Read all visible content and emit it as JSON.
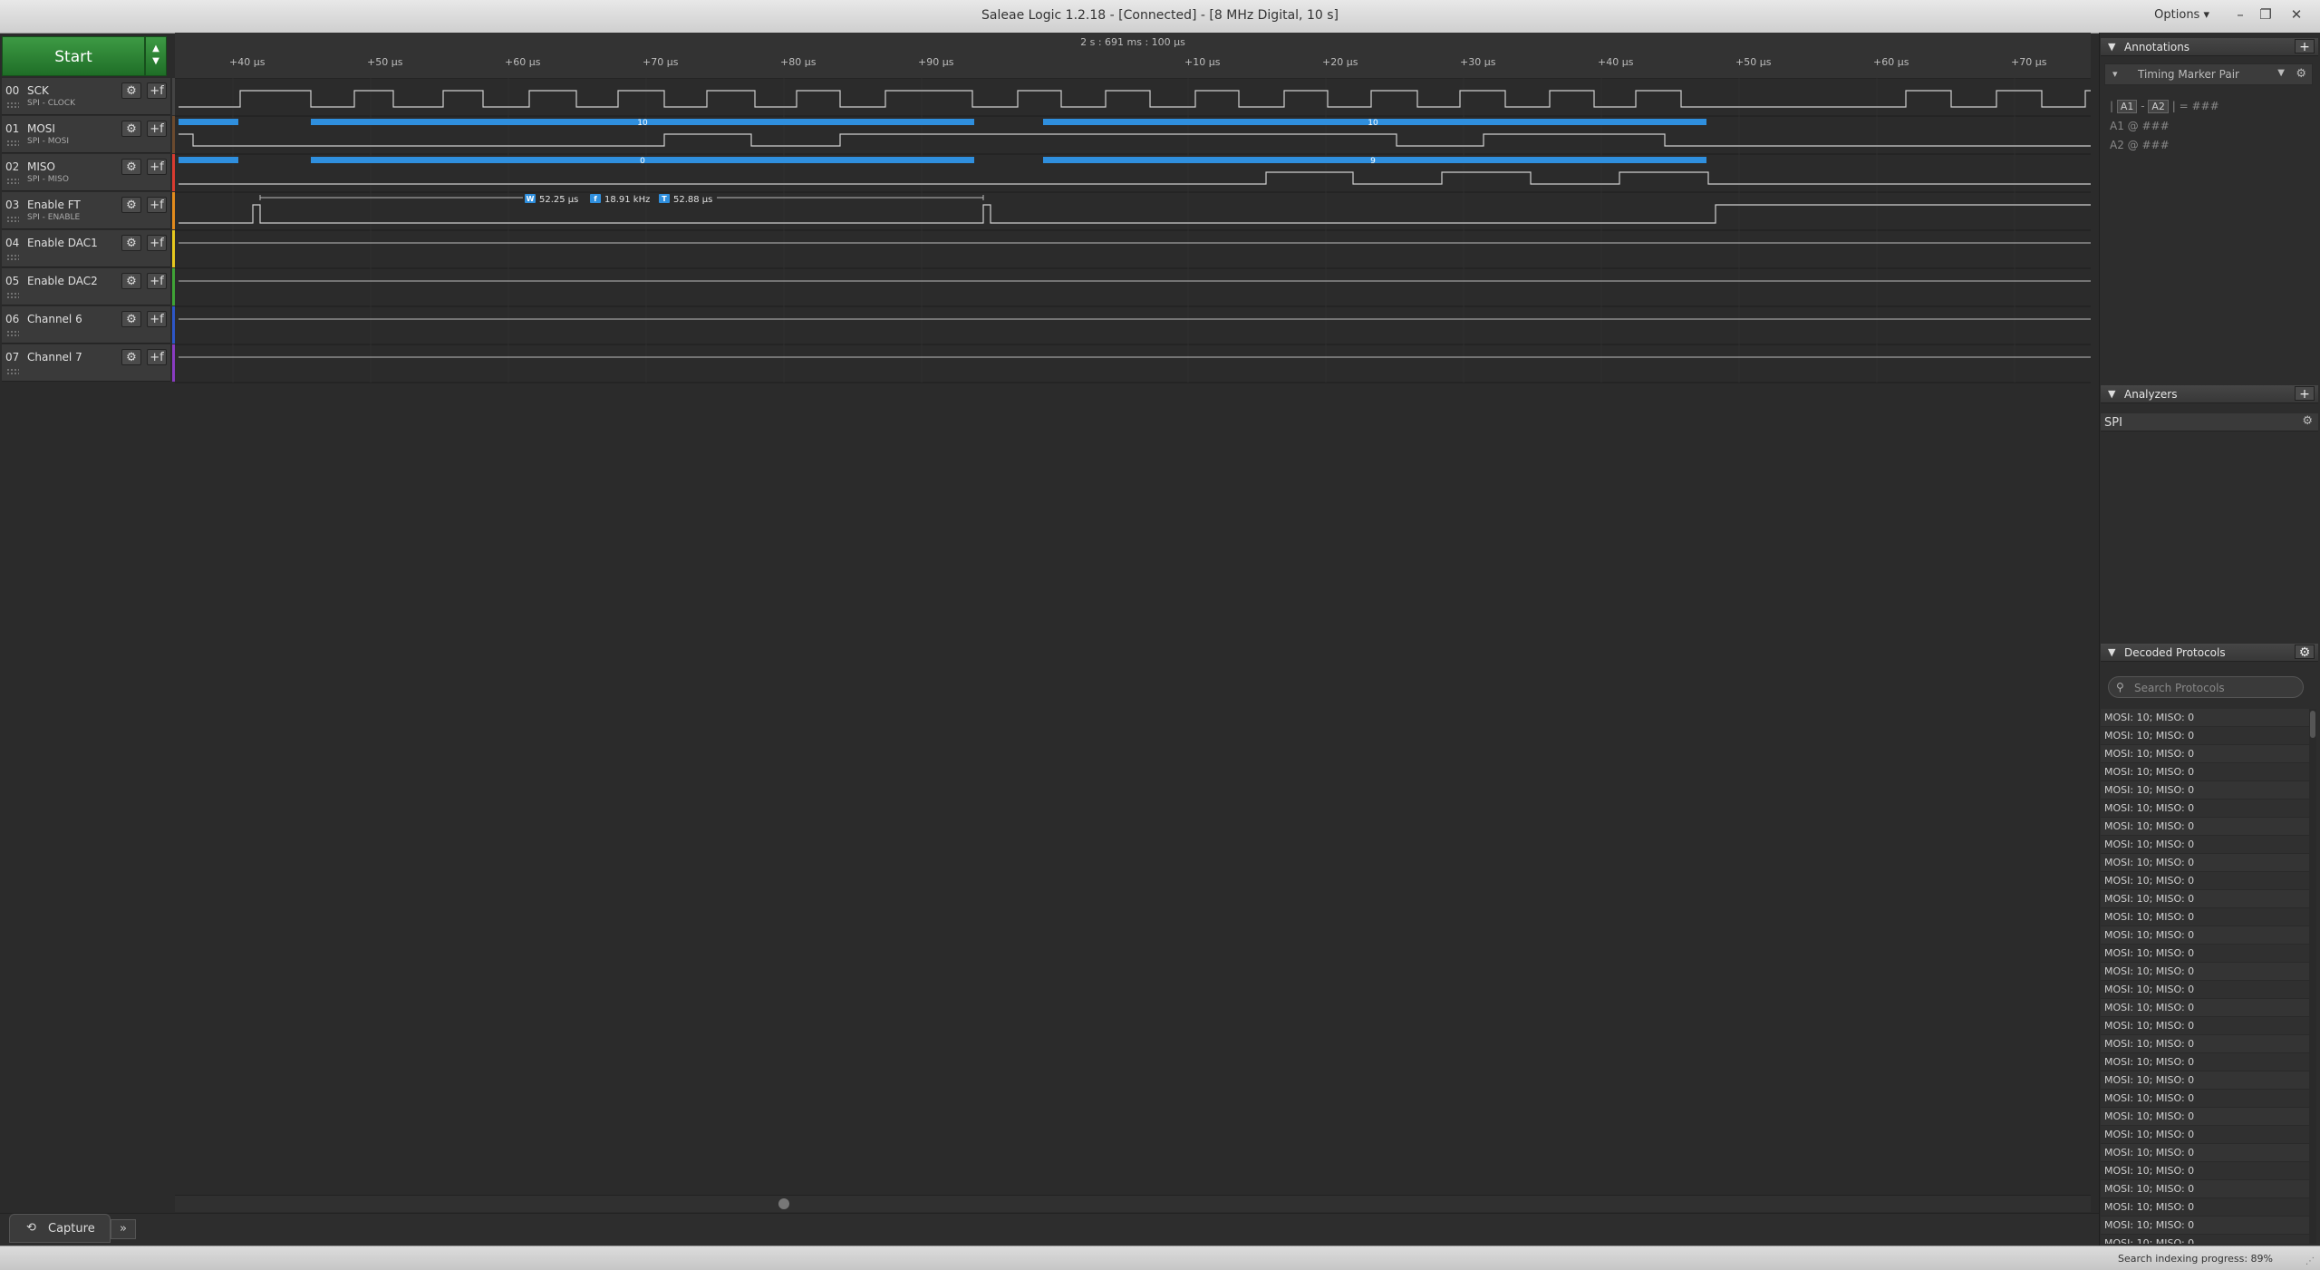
{
  "window": {
    "title": "Saleae Logic 1.2.18 - [Connected] - [8 MHz Digital, 10 s]",
    "options_label": "Options ▾",
    "minimize": "–",
    "restore": "❐",
    "close": "✕"
  },
  "start": {
    "label": "Start",
    "dropdown": "▲\n▼"
  },
  "channels": [
    {
      "num": "00",
      "name": "SCK",
      "sub": "SPI - CLOCK",
      "color": "#444444"
    },
    {
      "num": "01",
      "name": "MOSI",
      "sub": "SPI - MOSI",
      "color": "#6b4a2e"
    },
    {
      "num": "02",
      "name": "MISO",
      "sub": "SPI - MISO",
      "color": "#d93b30"
    },
    {
      "num": "03",
      "name": "Enable FT",
      "sub": "SPI - ENABLE",
      "color": "#e38b1c"
    },
    {
      "num": "04",
      "name": "Enable DAC1",
      "sub": "",
      "color": "#e6c81e"
    },
    {
      "num": "05",
      "name": "Enable DAC2",
      "sub": "",
      "color": "#3fa336"
    },
    {
      "num": "06",
      "name": "Channel 6",
      "sub": "",
      "color": "#2d56c7"
    },
    {
      "num": "07",
      "name": "Channel 7",
      "sub": "",
      "color": "#8a3cc2"
    }
  ],
  "channel_buttons": {
    "gear": "⚙",
    "trigger": "+f"
  },
  "ruler": {
    "range_label": "2 s : 691 ms : 100 μs",
    "ticks": [
      "+40 μs",
      "+50 μs",
      "+60 μs",
      "+70 μs",
      "+80 μs",
      "+90 μs",
      "+10 μs",
      "+20 μs",
      "+30 μs",
      "+40 μs",
      "+50 μs",
      "+60 μs",
      "+70 μs"
    ]
  },
  "decode_labels": {
    "mosi_a": "10",
    "mosi_b": "10",
    "miso_a": "0",
    "miso_b": "9"
  },
  "measurement": {
    "w_tag": "W",
    "w_value": "52.25 μs",
    "f_tag": "f",
    "f_value": "18.91 kHz",
    "t_tag": "T",
    "t_value": "52.88 μs"
  },
  "bottom": {
    "capture_label": "Capture",
    "capture_icon": "⟲",
    "expand": "»"
  },
  "annotations": {
    "header": "Annotations",
    "add": "+",
    "marker_label": "Timing Marker Pair",
    "line1_prefix": "|",
    "line1_a1": "A1",
    "line1_sep": "-",
    "line1_a2": "A2",
    "line1_suffix": "| = ###",
    "line2": "A1 @ ###",
    "line3": "A2 @ ###"
  },
  "analyzers": {
    "header": "Analyzers",
    "add": "+",
    "items": [
      "SPI"
    ]
  },
  "decoded": {
    "header": "Decoded Protocols",
    "search_placeholder": "Search Protocols",
    "row_text": "MOSI: 10;  MISO: 0",
    "row_count": 31
  },
  "status": {
    "text": "Search indexing progress: 89%"
  },
  "colors": {
    "accent_green": "#2f8a38",
    "decode_blue": "#2f8fde"
  }
}
